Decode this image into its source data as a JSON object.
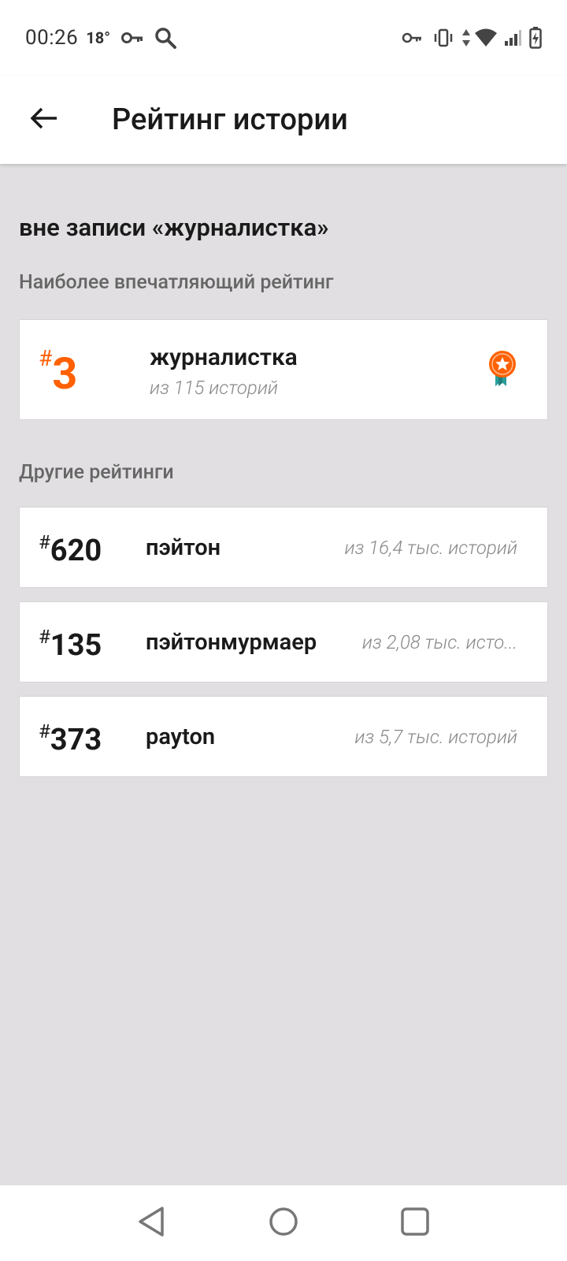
{
  "status_bar": {
    "time": "00:26",
    "temperature": "18°"
  },
  "app_bar": {
    "title": "Рейтинг истории"
  },
  "story": {
    "title": "вне записи «журналистка»"
  },
  "featured_section": {
    "label": "Наиболее впечатляющий рейтинг",
    "rank_hash": "#",
    "rank": "3",
    "tag": "журналистка",
    "subtitle": "из 115 историй"
  },
  "other_section": {
    "label": "Другие рейтинги",
    "items": [
      {
        "hash": "#",
        "rank": "620",
        "tag": "пэйтон",
        "subtitle": "из 16,4 тыс. историй"
      },
      {
        "hash": "#",
        "rank": "135",
        "tag": "пэйтонмурмаер",
        "subtitle": "из 2,08 тыс. исто..."
      },
      {
        "hash": "#",
        "rank": "373",
        "tag": "payton",
        "subtitle": "из 5,7 тыс. историй"
      }
    ]
  },
  "colors": {
    "accent": "#ff6000",
    "background": "#e1dfe1",
    "medal_ribbon": "#2a9d9a"
  },
  "icons": {
    "status": [
      "key-icon",
      "search-icon",
      "key-icon",
      "vibrate-icon",
      "data-arrows-icon",
      "wifi-icon",
      "signal-icon",
      "battery-charging-icon"
    ],
    "nav": [
      "back-triangle-icon",
      "home-circle-icon",
      "recents-square-icon"
    ]
  }
}
